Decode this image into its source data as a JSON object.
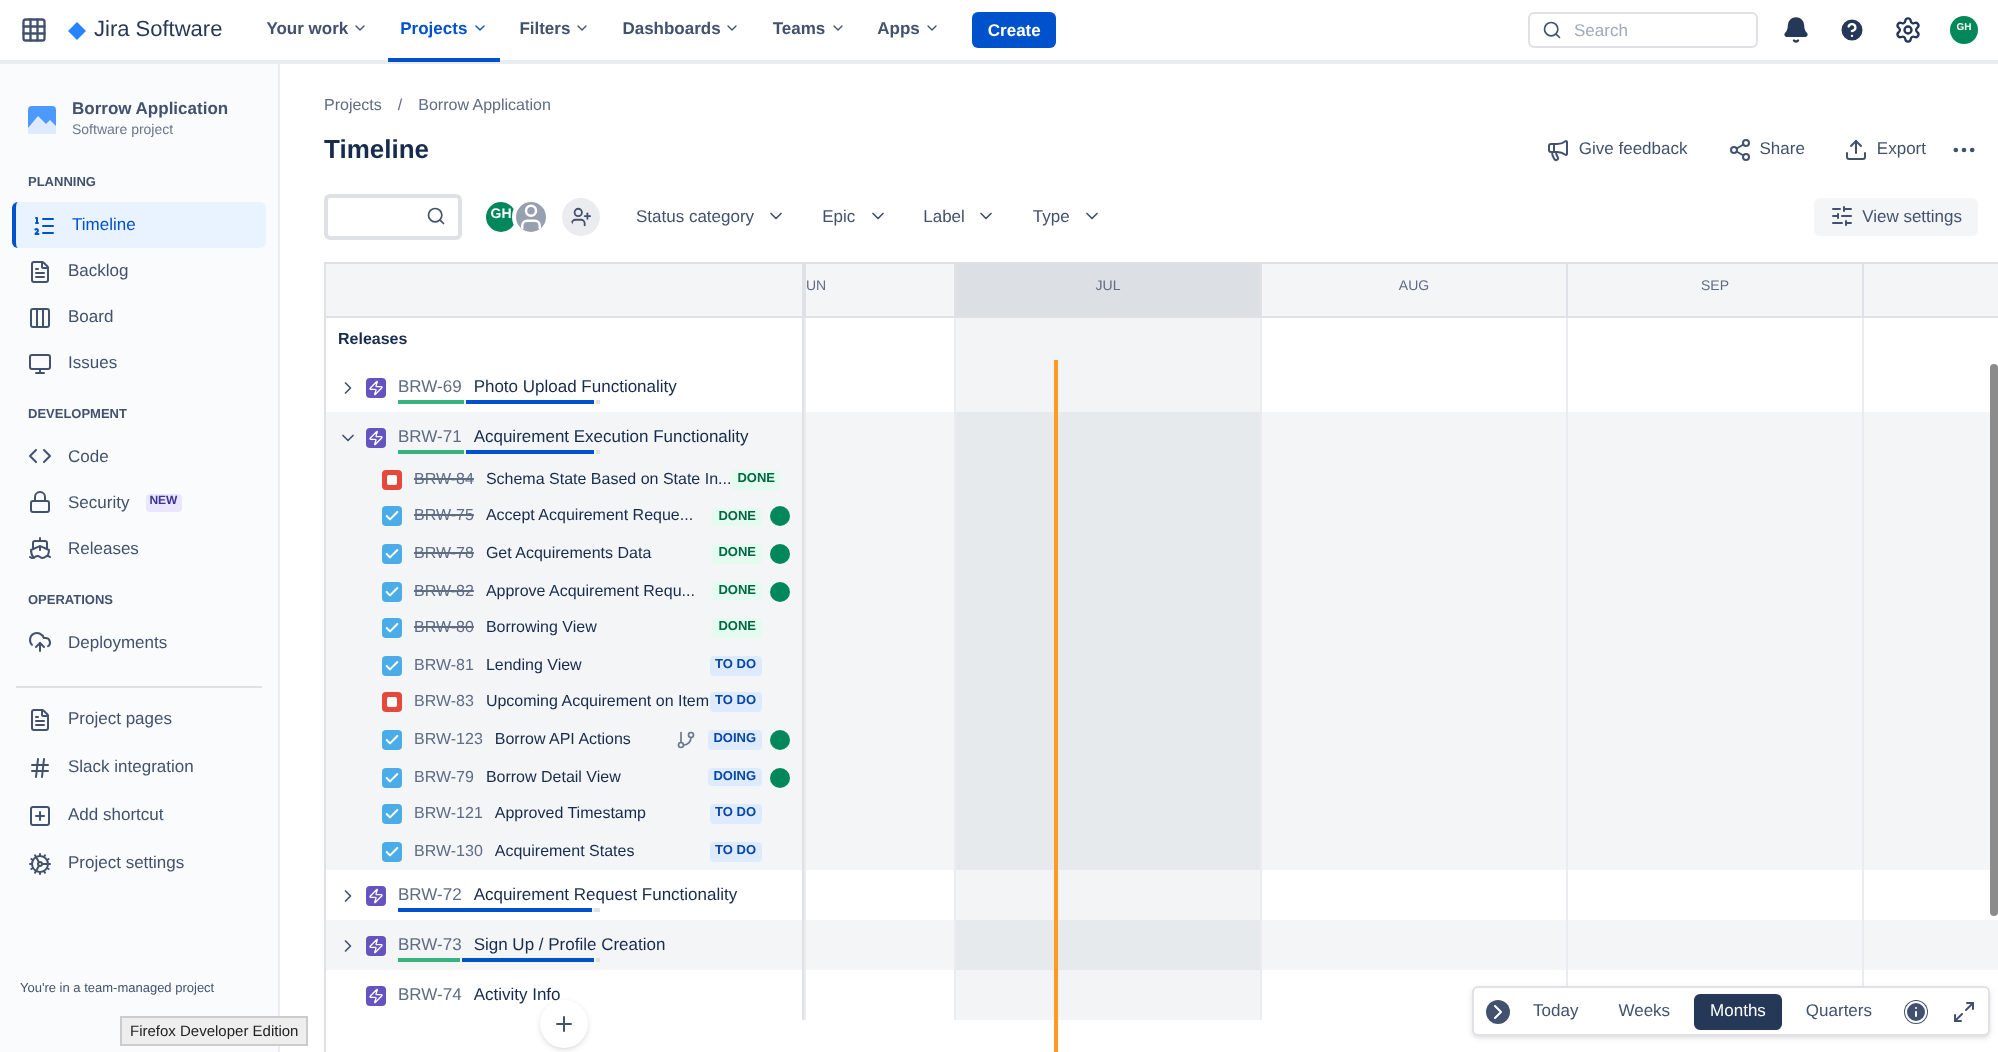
{
  "topbar": {
    "product": "Jira Software",
    "nav": [
      {
        "label": "Your work",
        "selected": false
      },
      {
        "label": "Projects",
        "selected": true
      },
      {
        "label": "Filters",
        "selected": false
      },
      {
        "label": "Dashboards",
        "selected": false
      },
      {
        "label": "Teams",
        "selected": false
      },
      {
        "label": "Apps",
        "selected": false
      }
    ],
    "create": "Create",
    "search": {
      "placeholder": "Search"
    },
    "avatar": "GH"
  },
  "sidebar": {
    "project": "Borrow Application",
    "project_type": "Software project",
    "sections": [
      {
        "title": "PLANNING",
        "items": [
          {
            "label": "Timeline",
            "selected": true
          },
          {
            "label": "Backlog",
            "selected": false
          },
          {
            "label": "Board",
            "selected": false
          },
          {
            "label": "Issues",
            "selected": false
          }
        ]
      },
      {
        "title": "DEVELOPMENT",
        "items": [
          {
            "label": "Code",
            "selected": false
          },
          {
            "label": "Security",
            "selected": false,
            "badge": "NEW"
          },
          {
            "label": "Releases",
            "selected": false
          }
        ]
      },
      {
        "title": "OPERATIONS",
        "items": [
          {
            "label": "Deployments",
            "selected": false
          }
        ]
      }
    ],
    "links": [
      "Project pages",
      "Slack integration",
      "Add shortcut",
      "Project settings"
    ],
    "footer": "You're in a team-managed project"
  },
  "tooltip": "Firefox Developer Edition",
  "breadcrumbs": {
    "items": [
      "Projects",
      "Borrow Application"
    ],
    "separator": "/"
  },
  "title": "Timeline",
  "actions": [
    "Give feedback",
    "Share",
    "Export"
  ],
  "filters": {
    "avatar": "GH",
    "dropdowns": [
      "Status category",
      "Epic",
      "Label",
      "Type"
    ],
    "view_settings": "View settings"
  },
  "timeline": {
    "releases_label": "Releases",
    "months": [
      {
        "label": "UN",
        "current": false
      },
      {
        "label": "JUL",
        "current": true
      },
      {
        "label": "AUG",
        "current": false
      },
      {
        "label": "SEP",
        "current": false
      },
      {
        "current": false
      }
    ],
    "epics": [
      {
        "key": "BRW-69",
        "title": "Photo Upload Functionality",
        "expanded": false,
        "expandable": true,
        "bars": [
          {
            "kind": "done",
            "level": 0.34
          },
          {
            "kind": "in_progress",
            "level": 0.64
          }
        ]
      },
      {
        "key": "BRW-71",
        "title": "Acquirement Execution Functionality",
        "expanded": true,
        "expandable": true,
        "bars": [
          {
            "kind": "done",
            "level": 0.34
          },
          {
            "kind": "in_progress",
            "level": 0.64
          }
        ],
        "children": [
          {
            "kind": "bug",
            "key": "BRW-84",
            "done": true,
            "title": "Schema State Based on State In...",
            "status": {
              "text": "DONE",
              "kind": "done"
            },
            "assigned": false,
            "child_issues": false
          },
          {
            "kind": "story",
            "key": "BRW-75",
            "done": true,
            "title": "Accept Acquirement Reque...",
            "status": {
              "text": "DONE",
              "kind": "done"
            },
            "assigned": true,
            "child_issues": false
          },
          {
            "kind": "story",
            "key": "BRW-78",
            "done": true,
            "title": "Get Acquirements Data",
            "status": {
              "text": "DONE",
              "kind": "done"
            },
            "assigned": true,
            "child_issues": false
          },
          {
            "kind": "story",
            "key": "BRW-82",
            "done": true,
            "title": "Approve Acquirement Requ...",
            "status": {
              "text": "DONE",
              "kind": "done"
            },
            "assigned": true,
            "child_issues": false
          },
          {
            "kind": "story",
            "key": "BRW-80",
            "done": true,
            "title": "Borrowing View",
            "status": {
              "text": "DONE",
              "kind": "done"
            },
            "assigned": false,
            "child_issues": false
          },
          {
            "kind": "story",
            "key": "BRW-81",
            "done": false,
            "title": "Lending View",
            "status": {
              "text": "TO DO",
              "kind": "todo"
            },
            "assigned": false,
            "child_issues": false
          },
          {
            "kind": "bug",
            "key": "BRW-83",
            "done": false,
            "title": "Upcoming Acquirement on Item",
            "status": {
              "text": "TO DO",
              "kind": "todo"
            },
            "assigned": false,
            "child_issues": false
          },
          {
            "kind": "story",
            "key": "BRW-123",
            "done": false,
            "title": "Borrow API Actions",
            "status": {
              "text": "DOING",
              "kind": "doing"
            },
            "assigned": true,
            "child_issues": true
          },
          {
            "kind": "story",
            "key": "BRW-79",
            "done": false,
            "title": "Borrow Detail View",
            "status": {
              "text": "DOING",
              "kind": "doing"
            },
            "assigned": true,
            "child_issues": false
          },
          {
            "kind": "story",
            "key": "BRW-121",
            "done": false,
            "title": "Approved Timestamp",
            "status": {
              "text": "TO DO",
              "kind": "todo"
            },
            "assigned": false,
            "child_issues": false
          },
          {
            "kind": "story",
            "key": "BRW-130",
            "done": false,
            "title": "Acquirement States",
            "status": {
              "text": "TO DO",
              "kind": "todo"
            },
            "assigned": false,
            "child_issues": false
          }
        ]
      },
      {
        "key": "BRW-72",
        "title": "Acquirement Request Functionality",
        "expanded": false,
        "expandable": true,
        "bars": [
          {
            "kind": "in_progress",
            "level": 0.97
          }
        ]
      },
      {
        "key": "BRW-73",
        "title": "Sign Up / Profile Creation",
        "expanded": false,
        "expandable": true,
        "bars": [
          {
            "kind": "done",
            "level": 0.32
          },
          {
            "kind": "in_progress",
            "level": 0.66
          }
        ]
      },
      {
        "key": "BRW-74",
        "title": "Activity Info",
        "expanded": false,
        "expandable": false
      }
    ]
  },
  "zoom": {
    "options": [
      {
        "label": "Today",
        "selected": false
      },
      {
        "label": "Weeks",
        "selected": false
      },
      {
        "label": "Months",
        "selected": true
      },
      {
        "label": "Quarters",
        "selected": false
      }
    ]
  }
}
